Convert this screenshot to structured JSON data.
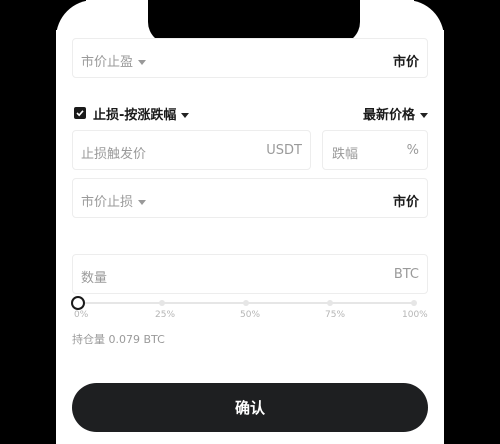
{
  "take_profit_row": {
    "order_type": "市价止盈",
    "price": "市价"
  },
  "stop_loss": {
    "checkbox_label": "止损-按涨跌幅",
    "price_type": "最新价格",
    "trigger_placeholder": "止损触发价",
    "trigger_unit": "USDT",
    "percent_placeholder": "跌幅",
    "percent_unit": "%",
    "order_type": "市价止损",
    "price": "市价"
  },
  "quantity": {
    "placeholder": "数量",
    "unit": "BTC"
  },
  "slider": {
    "value_fraction": 0.0,
    "marks": [
      "0%",
      "25%",
      "50%",
      "75%",
      "100%"
    ]
  },
  "position_info": "持仓量 0.079 BTC",
  "confirm_label": "确认"
}
